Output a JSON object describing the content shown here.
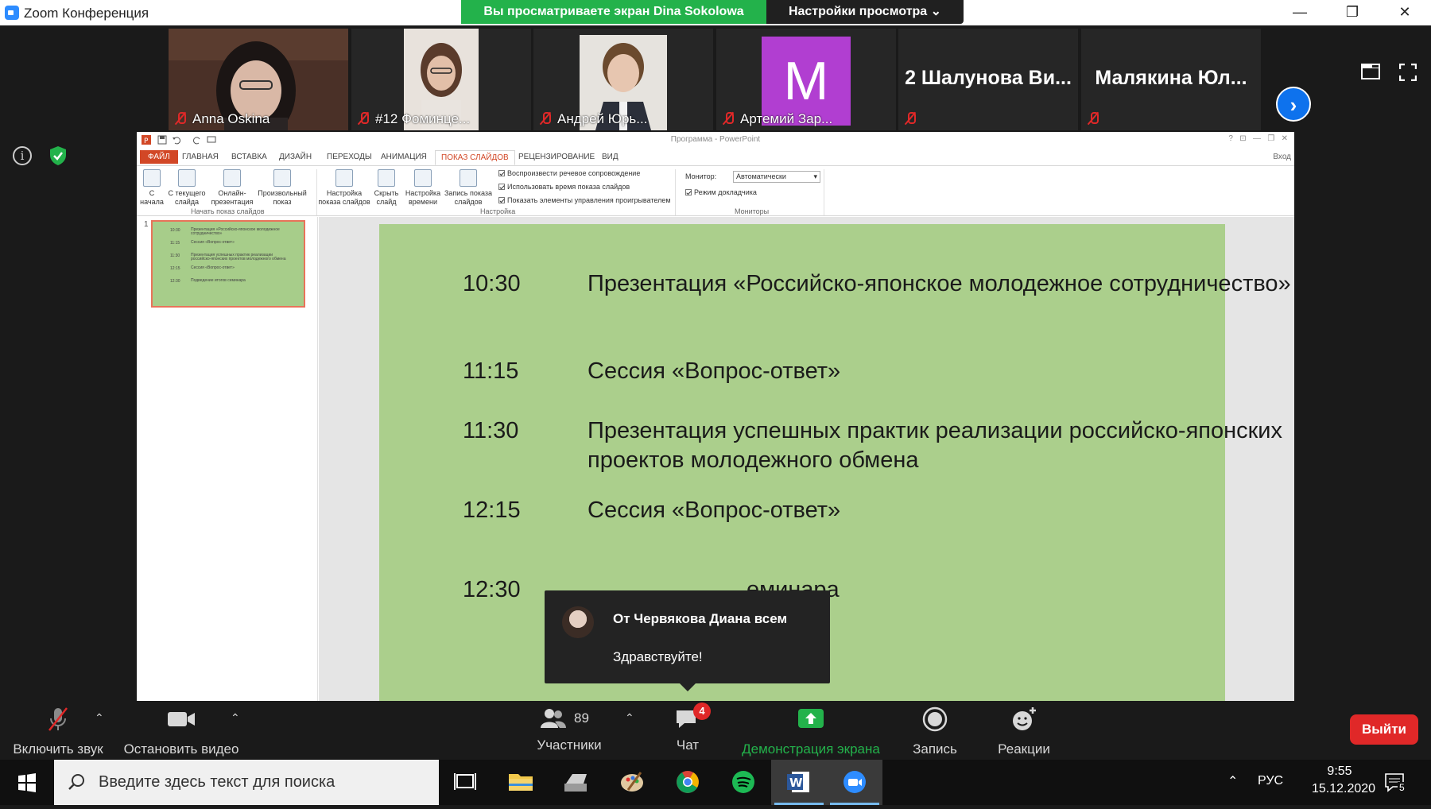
{
  "window": {
    "title": "Zoom Конференция"
  },
  "banner": {
    "sharing_text": "Вы просматриваете экран Dina Sokolowa",
    "view_options": "Настройки просмотра ⌄"
  },
  "participants": [
    {
      "name": "Anna Oskina"
    },
    {
      "name": "#12 Фоминце..."
    },
    {
      "name": "Андрей Юрь..."
    },
    {
      "name": "Артемий Зар...",
      "avatar_letter": "M"
    },
    {
      "name": "2 Шалунова Ви..."
    },
    {
      "name": "Малякина Юл..."
    }
  ],
  "ppt": {
    "doc_title": "Программа - PowerPoint",
    "login": "Вход",
    "tabs": [
      "ФАЙЛ",
      "ГЛАВНАЯ",
      "ВСТАВКА",
      "ДИЗАЙН",
      "ПЕРЕХОДЫ",
      "АНИМАЦИЯ",
      "ПОКАЗ СЛАЙДОВ",
      "РЕЦЕНЗИРОВАНИЕ",
      "ВИД"
    ],
    "ribbon": {
      "from_start": "С\nначала",
      "from_current": "С текущего\nслайда",
      "online": "Онлайн-\nпрезентация",
      "custom": "Произвольный\nпоказ",
      "group_start": "Начать показ слайдов",
      "setup": "Настройка\nпоказа слайдов",
      "hide": "Скрыть\nслайд",
      "rehearse": "Настройка\nвремени",
      "record": "Запись показа\nслайдов",
      "chk1": "Воспроизвести речевое сопровождение",
      "chk2": "Использовать время показа слайдов",
      "chk3": "Показать элементы управления проигрывателем",
      "group_setup": "Настройка",
      "monitor_label": "Монитор:",
      "monitor_value": "Автоматически",
      "presenter_view": "Режим докладчика",
      "group_monitors": "Мониторы"
    },
    "thumb_number": "1",
    "thumb_rows": [
      {
        "t": "10:30",
        "d": "Презентация «Российско-японское молодежное сотрудничество»"
      },
      {
        "t": "11:15",
        "d": "Сессия «Вопрос-ответ»"
      },
      {
        "t": "11:30",
        "d": "Презентация успешных практик реализации российско-японских проектов молодежного обмена"
      },
      {
        "t": "12:15",
        "d": "Сессия «Вопрос-ответ»"
      },
      {
        "t": "12:30",
        "d": "Подведение итогов семинара"
      }
    ]
  },
  "slide": {
    "rows": [
      {
        "time": "10:30",
        "desc": "Презентация «Российско-японское молодежное сотрудничество»"
      },
      {
        "time": "11:15",
        "desc": "Сессия «Вопрос-ответ»"
      },
      {
        "time": "11:30",
        "desc": "Презентация успешных практик реализации российско-японских проектов молодежного обмена"
      },
      {
        "time": "12:15",
        "desc": "Сессия «Вопрос-ответ»"
      },
      {
        "time": "12:30",
        "desc": "еминара"
      }
    ]
  },
  "toast": {
    "from": "От Червякова Диана всем",
    "message": "Здравствуйте!"
  },
  "controls": {
    "unmute": "Включить звук",
    "stop_video": "Остановить видео",
    "participants": "Участники",
    "participants_count": "89",
    "chat": "Чат",
    "chat_badge": "4",
    "share": "Демонстрация экрана",
    "record": "Запись",
    "reactions": "Реакции",
    "leave": "Выйти"
  },
  "taskbar": {
    "search_placeholder": "Введите здесь текст для поиска",
    "lang": "РУС",
    "time": "9:55",
    "date": "15.12.2020",
    "notifications": "5"
  },
  "colors": {
    "share_green": "#23b24b",
    "zoom_blue": "#0e72ed",
    "leave_red": "#e02828",
    "slide_green": "#abcf8c",
    "ppt_orange": "#d24726"
  }
}
